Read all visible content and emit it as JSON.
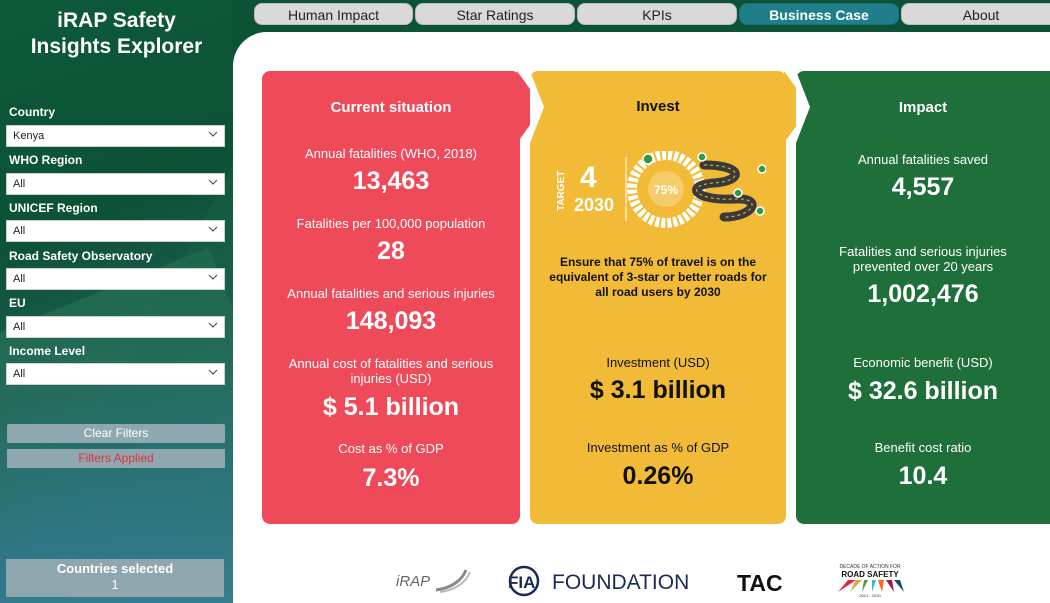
{
  "app": {
    "title_line1": "iRAP Safety",
    "title_line2": "Insights Explorer"
  },
  "tabs": [
    {
      "label": "Human Impact",
      "active": false
    },
    {
      "label": "Star Ratings",
      "active": false
    },
    {
      "label": "KPIs",
      "active": false
    },
    {
      "label": "Business Case",
      "active": true
    },
    {
      "label": "About",
      "active": false
    }
  ],
  "filters": [
    {
      "label": "Country",
      "value": "Kenya"
    },
    {
      "label": "WHO Region",
      "value": "All"
    },
    {
      "label": "UNICEF Region",
      "value": "All"
    },
    {
      "label": "Road Safety Observatory",
      "value": "All"
    },
    {
      "label": "EU",
      "value": "All"
    },
    {
      "label": "Income Level",
      "value": "All"
    }
  ],
  "sidebar": {
    "clear_filters": "Clear Filters",
    "filters_applied": "Filters Applied",
    "countries_selected_label": "Countries selected",
    "countries_selected_value": "1"
  },
  "current": {
    "title": "Current situation",
    "fatalities_label": "Annual fatalities (WHO, 2018)",
    "fatalities_value": "13,463",
    "per100k_label": "Fatalities per 100,000 population",
    "per100k_value": "28",
    "fsi_label": "Annual fatalities and serious injuries",
    "fsi_value": "148,093",
    "cost_label": "Annual cost of fatalities and serious injuries (USD)",
    "cost_value": "$ 5.1 billion",
    "gdp_label": "Cost as % of GDP",
    "gdp_value": "7.3%"
  },
  "invest": {
    "title": "Invest",
    "graphic_target": "TARGET",
    "graphic_number": "4",
    "graphic_year": "2030",
    "graphic_percent": "75%",
    "target_text": "Ensure that 75% of travel is on the equivalent of 3-star or better roads for all road users by 2030",
    "investment_label": "Investment (USD)",
    "investment_value": "$ 3.1 billion",
    "gdp_label": "Investment as % of GDP",
    "gdp_value": "0.26%"
  },
  "impact": {
    "title": "Impact",
    "saved_label": "Annual fatalities saved",
    "saved_value": "4,557",
    "prevented_label": "Fatalities and serious injuries prevented over 20 years",
    "prevented_value": "1,002,476",
    "benefit_label": "Economic benefit (USD)",
    "benefit_value": "$ 32.6 billion",
    "bcr_label": "Benefit cost ratio",
    "bcr_value": "10.4"
  },
  "logos": {
    "irap": "iRAP",
    "fia": "FOUNDATION",
    "fia_prefix": "FIA",
    "tac": "TAC",
    "decade_line1": "DECADE OF ACTION FOR",
    "decade_line2": "ROAD SAFETY",
    "decade_line3": "2021 - 2030"
  },
  "colors": {
    "red_panel": "#ef4a5a",
    "yellow_panel": "#f2bb37",
    "green_panel": "#1f6f3b",
    "active_tab": "#1e7e8a",
    "sidebar_green": "#0c5234"
  }
}
